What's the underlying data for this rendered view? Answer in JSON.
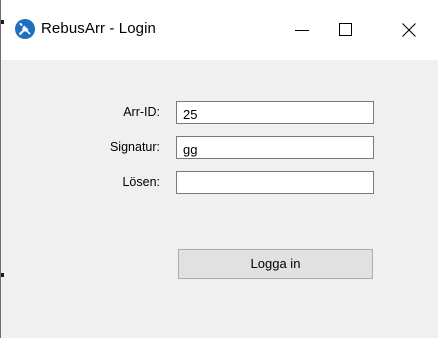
{
  "window": {
    "title": "RebusArr - Login",
    "app_icon": "wrench-screwdriver-icon",
    "controls": {
      "minimize_icon": "minimize-icon",
      "maximize_icon": "maximize-icon",
      "close_icon": "close-icon"
    }
  },
  "form": {
    "arr_id": {
      "label": "Arr-ID:",
      "value": "25"
    },
    "signatur": {
      "label": "Signatur:",
      "value": "gg"
    },
    "losen": {
      "label": "Lösen:",
      "value": ""
    },
    "login_button_label": "Logga in"
  },
  "colors": {
    "icon_blue": "#1e6fbf",
    "window_bg": "#f0f0f0",
    "titlebar_bg": "#ffffff",
    "button_bg": "#e1e1e1"
  }
}
